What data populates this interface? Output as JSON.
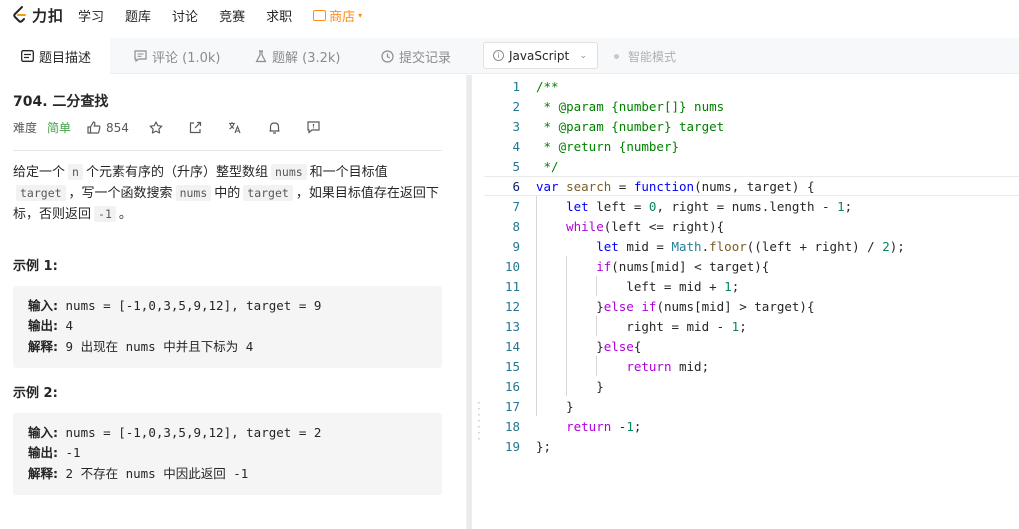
{
  "nav": {
    "logo_text": "力扣",
    "items": [
      "学习",
      "题库",
      "讨论",
      "竞赛",
      "求职"
    ],
    "shop": "商店",
    "shop_color": "#ff8c1a"
  },
  "tabs": {
    "description": "题目描述",
    "comments": "评论 (1.0k)",
    "solutions": "题解 (3.2k)",
    "submissions": "提交记录"
  },
  "editor_toolbar": {
    "language": "JavaScript",
    "smart_mode": "智能模式"
  },
  "problem": {
    "title": "704. 二分查找",
    "difficulty_label": "难度",
    "difficulty": "简单",
    "likes": "854",
    "desc_1": "给定一个",
    "code_n": "n",
    "desc_2": "个元素有序的（升序）整型数组",
    "code_nums": "nums",
    "desc_3": "和一个目标值",
    "code_target": "target",
    "desc_4": "，写一个函数搜索",
    "desc_5": "中的",
    "desc_6": "，如果目标值存在返回下标，否则返回",
    "code_neg1": "-1",
    "desc_7": "。"
  },
  "examples": [
    {
      "title": "示例 1:",
      "input_label": "输入:",
      "input": "nums = [-1,0,3,5,9,12], target = 9",
      "output_label": "输出:",
      "output": "4",
      "explain_label": "解释:",
      "explain": "9 出现在 nums 中并且下标为 4"
    },
    {
      "title": "示例 2:",
      "input_label": "输入:",
      "input": "nums = [-1,0,3,5,9,12], target = 2",
      "output_label": "输出:",
      "output": "-1",
      "explain_label": "解释:",
      "explain": "2 不存在 nums 中因此返回 -1"
    }
  ],
  "code": {
    "current_line": 6,
    "lines": [
      "/**",
      " * @param {number[]} nums",
      " * @param {number} target",
      " * @return {number}",
      " */",
      "var search = function(nums, target) {",
      "    let left = 0, right = nums.length - 1;",
      "    while(left <= right){",
      "        let mid = Math.floor((left + right) / 2);",
      "        if(nums[mid] < target){",
      "            left = mid + 1;",
      "        }else if(nums[mid] > target){",
      "            right = mid - 1;",
      "        }else{",
      "            return mid;",
      "        }",
      "    }",
      "    return -1;",
      "};"
    ]
  }
}
